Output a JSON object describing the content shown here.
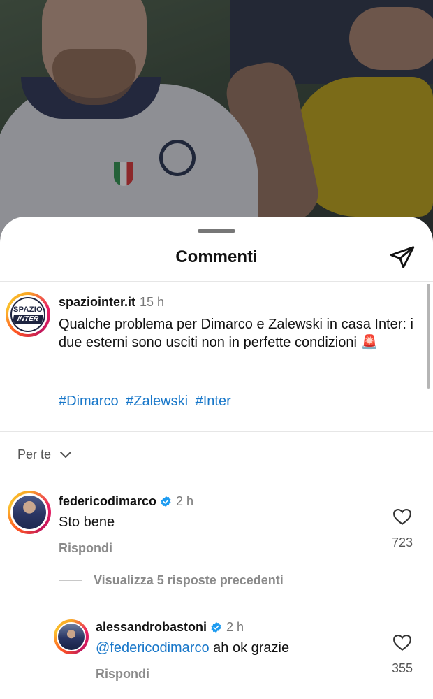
{
  "sheet": {
    "title": "Commenti"
  },
  "caption": {
    "username": "spaziointer.it",
    "time": "15 h",
    "avatar_top": "SPAZIO",
    "avatar_bottom": "INTER",
    "text": "Qualche problema per Dimarco e Zalewski in casa Inter: i due esterni sono usciti non in perfette condizioni 🚨",
    "hashtags": [
      "#Dimarco",
      "#Zalewski",
      "#Inter"
    ]
  },
  "sort": {
    "label": "Per te"
  },
  "comments": [
    {
      "username": "federicodimarco",
      "time": "2 h",
      "verified": true,
      "text": "Sto bene",
      "reply_label": "Rispondi",
      "likes": "723"
    }
  ],
  "view_replies": {
    "label": "Visualizza 5 risposte precedenti"
  },
  "replies": [
    {
      "username": "alessandrobastoni",
      "time": "2 h",
      "verified": true,
      "mention": "@federicodimarco",
      "text": " ah ok grazie",
      "reply_label": "Rispondi",
      "likes": "355"
    }
  ],
  "colors": {
    "link": "#1877c9",
    "verified": "#1d9bf0"
  }
}
